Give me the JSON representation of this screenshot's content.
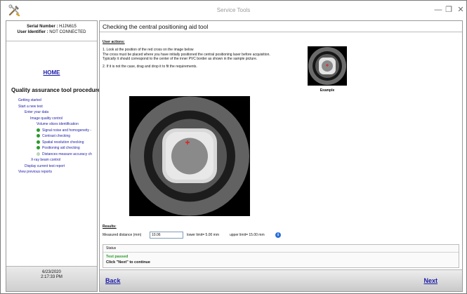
{
  "window": {
    "title": "Service Tools",
    "icons": [
      "tools-icon",
      "minimize-icon",
      "restore-icon",
      "close-icon"
    ]
  },
  "left_pane": {
    "serial_label": "Serial Number :",
    "serial_value": "HJJN615",
    "user_label": "User Identifier :",
    "user_value": "NOT CONNECTED",
    "home_link": "HOME",
    "procedure_title": "Quality assurance tool procedure",
    "nav_items": [
      {
        "label": "Getting started",
        "level": 0,
        "status": null
      },
      {
        "label": "Start a new test",
        "level": 0,
        "status": null
      },
      {
        "label": "Enter your data",
        "level": 1,
        "status": null
      },
      {
        "label": "Image quality control",
        "level": 2,
        "status": null
      },
      {
        "label": "Volume slices identification",
        "level": 3,
        "status": null
      },
      {
        "label": "Signal noise and homogeneity -",
        "level": 4,
        "status": "done"
      },
      {
        "label": "Contrast checking",
        "level": 4,
        "status": "done"
      },
      {
        "label": "Spatial resolution checking",
        "level": 4,
        "status": "done"
      },
      {
        "label": "Positioning aid checking",
        "level": 4,
        "status": "done"
      },
      {
        "label": "Distances measure accuracy ch",
        "level": 4,
        "status": "pending"
      },
      {
        "label": "X-ray beam control",
        "level": 2,
        "status": null
      },
      {
        "label": "Display current test report",
        "level": 1,
        "status": null
      },
      {
        "label": "View previous reports",
        "level": 0,
        "status": null
      }
    ],
    "date": "6/23/2020",
    "time": "2:17:33 PM"
  },
  "main": {
    "title": "Checking the central positioning aid tool",
    "user_actions_label": "User actions:",
    "instruction_1_line1": "1. Look at the position of the red cross on the image below",
    "instruction_1_line2": "The cross must be placed where you have initially positioned the central positioning laser before acquisition.",
    "instruction_1_line3": "Typically it should correspond to the center of the inner PVC border as shown in the sample picture.",
    "instruction_2": "2. If it is not the case, drag and drop it to fit the requirements.",
    "example_label": "Example",
    "results_label": "Results:",
    "measured_label": "Measured distance (mm)",
    "measured_value": "10.06",
    "lower_limit": "lower limit= 5.00 mm",
    "upper_limit": "upper limit= 15.00 mm",
    "status_header": "Status",
    "status_message": "Test passed",
    "status_instruction": "Click \"Next\" to continue",
    "back_label": "Back",
    "next_label": "Next"
  },
  "colors": {
    "link": "#1a1aa8",
    "done_dot": "#2a9a2a",
    "pending_dot": "#b9d6b9",
    "passed_text": "#2a9a2a"
  }
}
